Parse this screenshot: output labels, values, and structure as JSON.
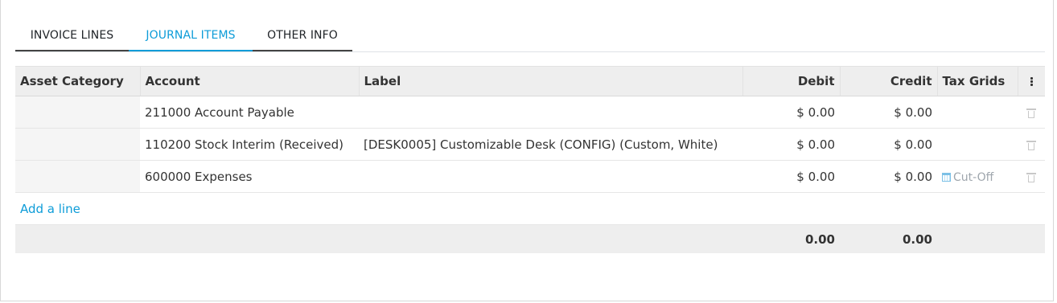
{
  "tabs": [
    {
      "label": "INVOICE LINES"
    },
    {
      "label": "JOURNAL ITEMS"
    },
    {
      "label": "OTHER INFO"
    }
  ],
  "active_tab": "JOURNAL ITEMS",
  "accent_color": "#0d9cd8",
  "table": {
    "headers": {
      "asset_category": "Asset Category",
      "account": "Account",
      "label": "Label",
      "debit": "Debit",
      "credit": "Credit",
      "tax_grids": "Tax Grids"
    },
    "rows": [
      {
        "asset_category": "",
        "account": "211000 Account Payable",
        "label": "",
        "debit": "$ 0.00",
        "credit": "$ 0.00",
        "tax_grids": ""
      },
      {
        "asset_category": "",
        "account": "110200 Stock Interim (Received)",
        "label": "[DESK0005] Customizable Desk (CONFIG) (Custom, White)",
        "debit": "$ 0.00",
        "credit": "$ 0.00",
        "tax_grids": ""
      },
      {
        "asset_category": "",
        "account": "600000 Expenses",
        "label": "",
        "debit": "$ 0.00",
        "credit": "$ 0.00",
        "tax_grids": "Cut-Off"
      }
    ],
    "add_line": "Add a line",
    "totals": {
      "debit": "0.00",
      "credit": "0.00"
    }
  },
  "icons": [
    "trash-icon",
    "calendar-icon",
    "kebab-menu-icon"
  ]
}
